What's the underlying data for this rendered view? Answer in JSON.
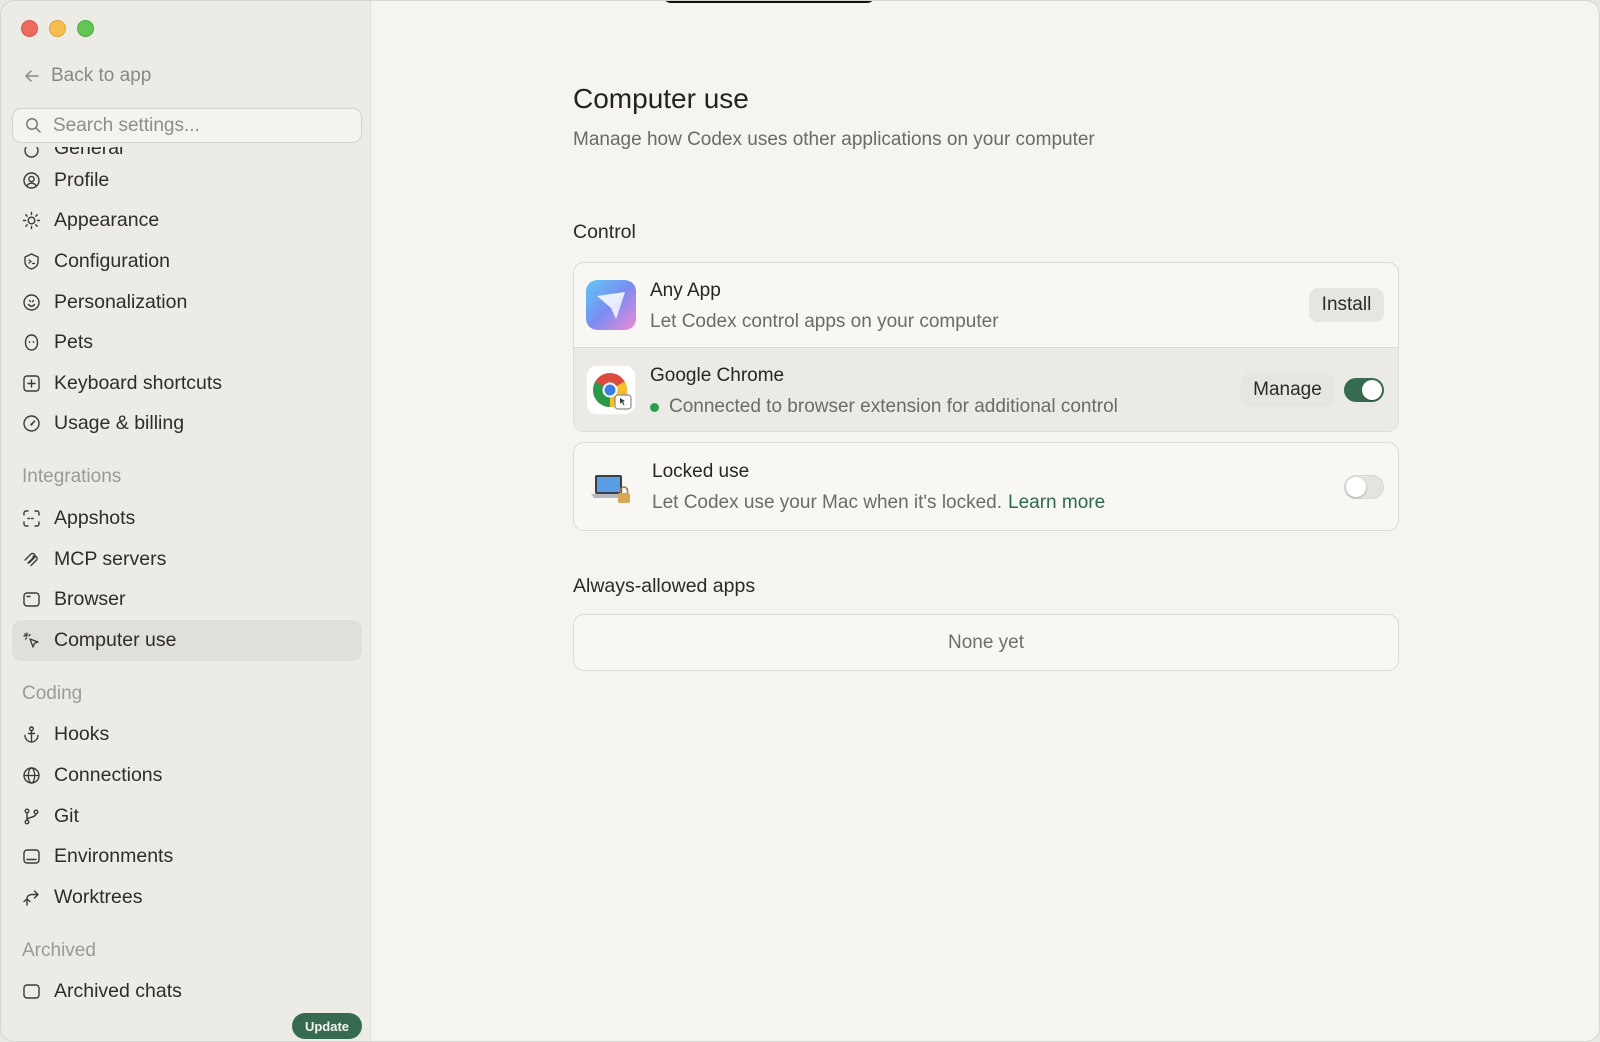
{
  "sidebar": {
    "back_label": "Back to app",
    "search_placeholder": "Search settings...",
    "cut_top_label": "General",
    "items": [
      {
        "label": "Profile",
        "icon": "profile-icon"
      },
      {
        "label": "Appearance",
        "icon": "sun-icon"
      },
      {
        "label": "Configuration",
        "icon": "configuration-icon"
      },
      {
        "label": "Personalization",
        "icon": "personalization-icon"
      },
      {
        "label": "Pets",
        "icon": "pet-icon"
      },
      {
        "label": "Keyboard shortcuts",
        "icon": "keyboard-icon"
      },
      {
        "label": "Usage & billing",
        "icon": "gauge-icon"
      }
    ],
    "integrations": {
      "heading": "Integrations",
      "items": [
        {
          "label": "Appshots",
          "icon": "appshots-icon"
        },
        {
          "label": "MCP servers",
          "icon": "mcp-icon"
        },
        {
          "label": "Browser",
          "icon": "browser-icon"
        },
        {
          "label": "Computer use",
          "icon": "cursor-click-icon",
          "active": true
        }
      ]
    },
    "coding": {
      "heading": "Coding",
      "items": [
        {
          "label": "Hooks",
          "icon": "anchor-icon"
        },
        {
          "label": "Connections",
          "icon": "globe-icon"
        },
        {
          "label": "Git",
          "icon": "git-branch-icon"
        },
        {
          "label": "Environments",
          "icon": "environment-icon"
        },
        {
          "label": "Worktrees",
          "icon": "worktree-icon"
        }
      ]
    },
    "archived": {
      "heading": "Archived",
      "cut_item_label": "Archived chats"
    },
    "update_label": "Update"
  },
  "main": {
    "title": "Computer use",
    "subtitle": "Manage how Codex uses other applications on your computer",
    "control": {
      "heading": "Control",
      "any_app": {
        "title": "Any App",
        "subtitle": "Let Codex control apps on your computer",
        "button": "Install"
      },
      "chrome": {
        "title": "Google Chrome",
        "status": "Connected to browser extension for additional control",
        "button": "Manage",
        "enabled": true
      },
      "locked": {
        "title": "Locked use",
        "subtitle": "Let Codex use your Mac when it's locked.",
        "link": "Learn more",
        "enabled": false
      }
    },
    "always_allowed": {
      "heading": "Always-allowed apps",
      "empty": "None yet"
    }
  },
  "colors": {
    "accent": "#366b4f",
    "status_green": "#2b9e4e"
  }
}
